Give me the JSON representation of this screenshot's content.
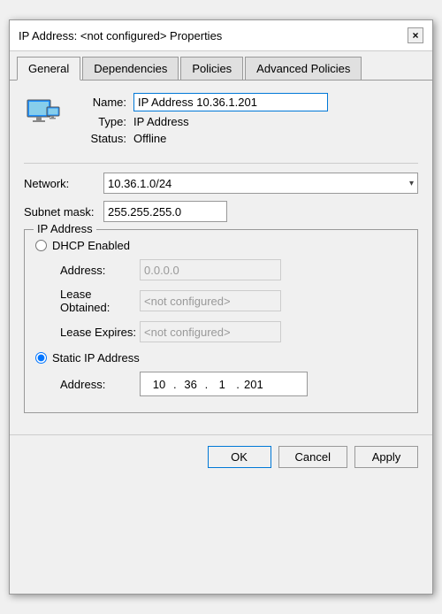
{
  "dialog": {
    "title": "IP Address: <not configured> Properties",
    "close_button": "×"
  },
  "tabs": [
    {
      "label": "General",
      "active": true
    },
    {
      "label": "Dependencies",
      "active": false
    },
    {
      "label": "Policies",
      "active": false
    },
    {
      "label": "Advanced Policies",
      "active": false
    }
  ],
  "resource": {
    "name_label": "Name:",
    "name_value": "IP Address 10.36.1.201",
    "type_label": "Type:",
    "type_value": "IP Address",
    "status_label": "Status:",
    "status_value": "Offline"
  },
  "network": {
    "network_label": "Network:",
    "network_value": "10.36.1.0/24",
    "subnet_label": "Subnet mask:",
    "subnet_value": "255.255.255.0"
  },
  "ip_group": {
    "label": "IP Address",
    "dhcp_label": "DHCP Enabled",
    "address_label": "Address:",
    "address_value": "0.0.0.0",
    "lease_obtained_label": "Lease Obtained:",
    "lease_obtained_value": "<not configured>",
    "lease_expires_label": "Lease Expires:",
    "lease_expires_value": "<not configured>",
    "static_label": "Static IP Address",
    "static_address_label": "Address:",
    "ip_parts": [
      "10",
      "36",
      "1",
      "201"
    ]
  },
  "buttons": {
    "ok": "OK",
    "cancel": "Cancel",
    "apply": "Apply"
  }
}
